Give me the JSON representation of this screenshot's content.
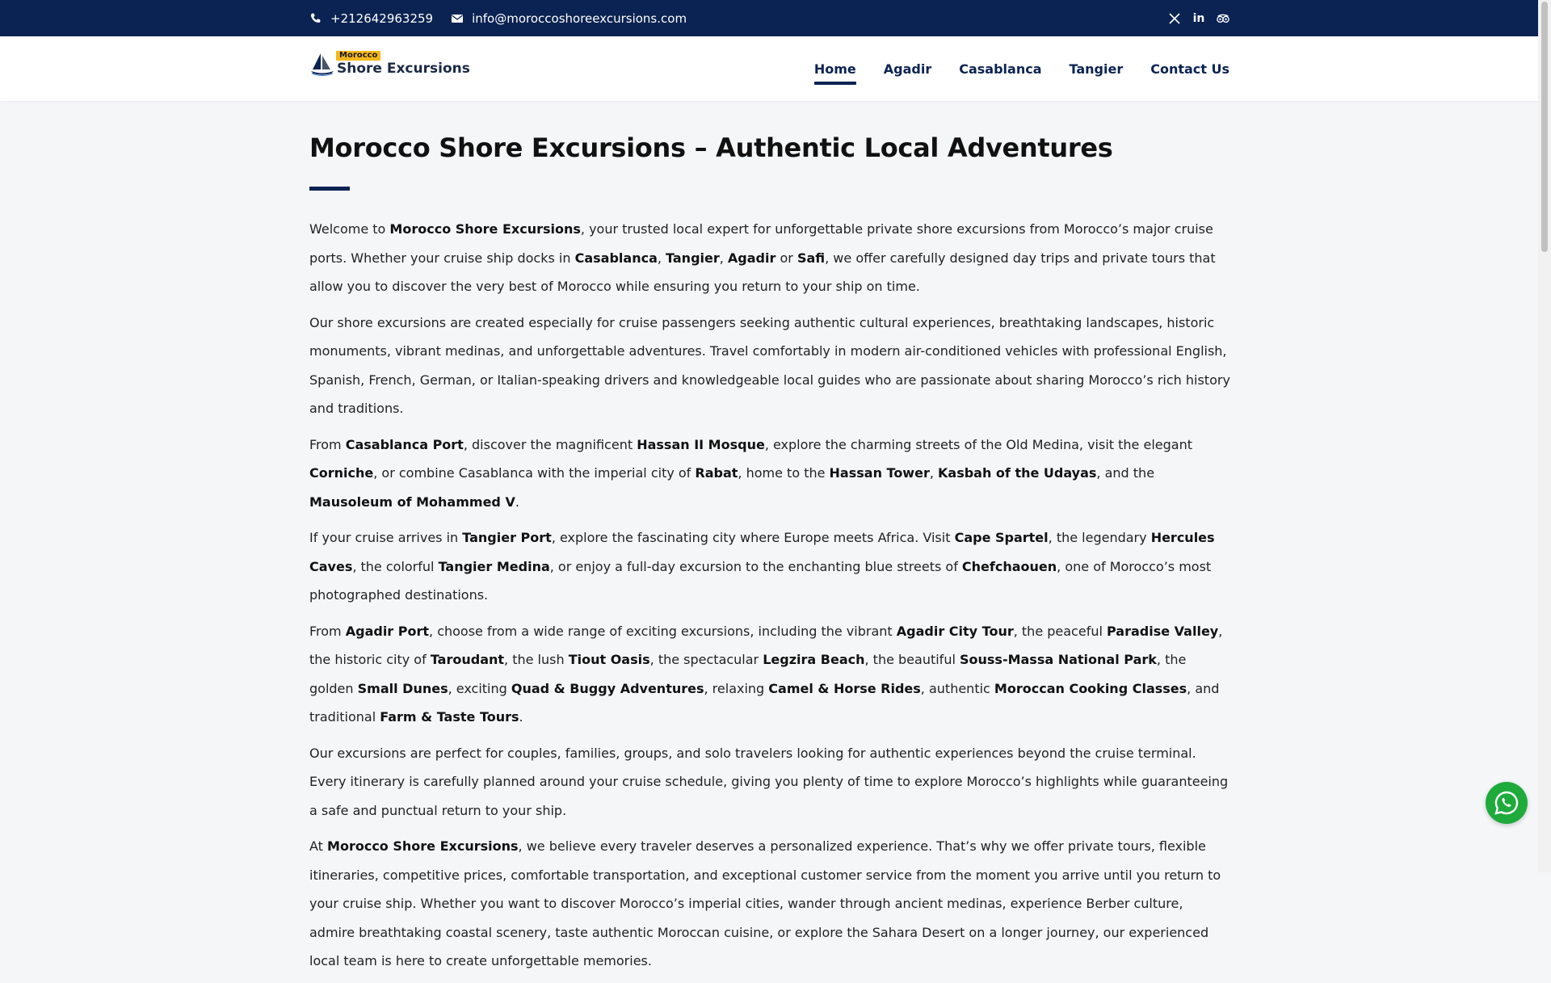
{
  "topbar": {
    "phone": "+212642963259",
    "email": "info@moroccoshoreexcursions.com",
    "social": [
      {
        "icon": "x-twitter-icon",
        "glyph": "𝕏"
      },
      {
        "icon": "linkedin-icon",
        "glyph": "in"
      },
      {
        "icon": "tripadvisor-icon",
        "glyph": "⊚"
      }
    ]
  },
  "header": {
    "logo_tag": "Morocco",
    "logo_name": "Shore Excursions",
    "nav": [
      {
        "label": "Home",
        "active": true
      },
      {
        "label": "Agadir",
        "active": false
      },
      {
        "label": "Casablanca",
        "active": false
      },
      {
        "label": "Tangier",
        "active": false
      },
      {
        "label": "Contact Us",
        "active": false
      }
    ]
  },
  "main": {
    "title": "Morocco Shore Excursions – Authentic Local Adventures",
    "paragraphs": [
      [
        {
          "t": "Welcome to "
        },
        {
          "t": "Morocco Shore Excursions",
          "b": true
        },
        {
          "t": ", your trusted local expert for unforgettable private shore excursions from Morocco’s major cruise ports. Whether your cruise ship docks in "
        },
        {
          "t": "Casablanca",
          "b": true
        },
        {
          "t": ", "
        },
        {
          "t": "Tangier",
          "b": true
        },
        {
          "t": ", "
        },
        {
          "t": "Agadir",
          "b": true
        },
        {
          "t": " or "
        },
        {
          "t": "Safi",
          "b": true
        },
        {
          "t": ", we offer carefully designed day trips and private tours that allow you to discover the very best of Morocco while ensuring you return to your ship on time."
        }
      ],
      [
        {
          "t": "Our shore excursions are created especially for cruise passengers seeking authentic cultural experiences, breathtaking landscapes, historic monuments, vibrant medinas, and unforgettable adventures. Travel comfortably in modern air-conditioned vehicles with professional English, Spanish, French, German, or Italian-speaking drivers and knowledgeable local guides who are passionate about sharing Morocco’s rich history and traditions."
        }
      ],
      [
        {
          "t": "From "
        },
        {
          "t": "Casablanca Port",
          "b": true
        },
        {
          "t": ", discover the magnificent "
        },
        {
          "t": "Hassan II Mosque",
          "b": true
        },
        {
          "t": ", explore the charming streets of the Old Medina, visit the elegant "
        },
        {
          "t": "Corniche",
          "b": true
        },
        {
          "t": ", or combine Casablanca with the imperial city of "
        },
        {
          "t": "Rabat",
          "b": true
        },
        {
          "t": ", home to the "
        },
        {
          "t": "Hassan Tower",
          "b": true
        },
        {
          "t": ", "
        },
        {
          "t": "Kasbah of the Udayas",
          "b": true
        },
        {
          "t": ", and the "
        },
        {
          "t": "Mausoleum of Mohammed V",
          "b": true
        },
        {
          "t": "."
        }
      ],
      [
        {
          "t": "If your cruise arrives in "
        },
        {
          "t": "Tangier Port",
          "b": true
        },
        {
          "t": ", explore the fascinating city where Europe meets Africa. Visit "
        },
        {
          "t": "Cape Spartel",
          "b": true
        },
        {
          "t": ", the legendary "
        },
        {
          "t": "Hercules Caves",
          "b": true
        },
        {
          "t": ", the colorful "
        },
        {
          "t": "Tangier Medina",
          "b": true
        },
        {
          "t": ", or enjoy a full-day excursion to the enchanting blue streets of "
        },
        {
          "t": "Chefchaouen",
          "b": true
        },
        {
          "t": ", one of Morocco’s most photographed destinations."
        }
      ],
      [
        {
          "t": "From "
        },
        {
          "t": "Agadir Port",
          "b": true
        },
        {
          "t": ", choose from a wide range of exciting excursions, including the vibrant "
        },
        {
          "t": "Agadir City Tour",
          "b": true
        },
        {
          "t": ", the peaceful "
        },
        {
          "t": "Paradise Valley",
          "b": true
        },
        {
          "t": ", the historic city of "
        },
        {
          "t": "Taroudant",
          "b": true
        },
        {
          "t": ", the lush "
        },
        {
          "t": "Tiout Oasis",
          "b": true
        },
        {
          "t": ", the spectacular "
        },
        {
          "t": "Legzira Beach",
          "b": true
        },
        {
          "t": ", the beautiful "
        },
        {
          "t": "Souss-Massa National Park",
          "b": true
        },
        {
          "t": ", the golden "
        },
        {
          "t": "Small Dunes",
          "b": true
        },
        {
          "t": ", exciting "
        },
        {
          "t": "Quad & Buggy Adventures",
          "b": true
        },
        {
          "t": ", relaxing "
        },
        {
          "t": "Camel & Horse Rides",
          "b": true
        },
        {
          "t": ", authentic "
        },
        {
          "t": "Moroccan Cooking Classes",
          "b": true
        },
        {
          "t": ", and traditional "
        },
        {
          "t": "Farm & Taste Tours",
          "b": true
        },
        {
          "t": "."
        }
      ],
      [
        {
          "t": "Our excursions are perfect for couples, families, groups, and solo travelers looking for authentic experiences beyond the cruise terminal. Every itinerary is carefully planned around your cruise schedule, giving you plenty of time to explore Morocco’s highlights while guaranteeing a safe and punctual return to your ship."
        }
      ],
      [
        {
          "t": "At "
        },
        {
          "t": "Morocco Shore Excursions",
          "b": true
        },
        {
          "t": ", we believe every traveler deserves a personalized experience. That’s why we offer private tours, flexible itineraries, competitive prices, comfortable transportation, and exceptional customer service from the moment you arrive until you return to your cruise ship. Whether you want to discover Morocco’s imperial cities, wander through ancient medinas, experience Berber culture, admire breathtaking coastal scenery, taste authentic Moroccan cuisine, or explore the Sahara Desert on a longer journey, our experienced local team is here to create unforgettable memories."
        }
      ]
    ]
  },
  "colors": {
    "navy": "#0b2352",
    "accent": "#f4b81d",
    "whatsapp": "#1faa3c"
  }
}
